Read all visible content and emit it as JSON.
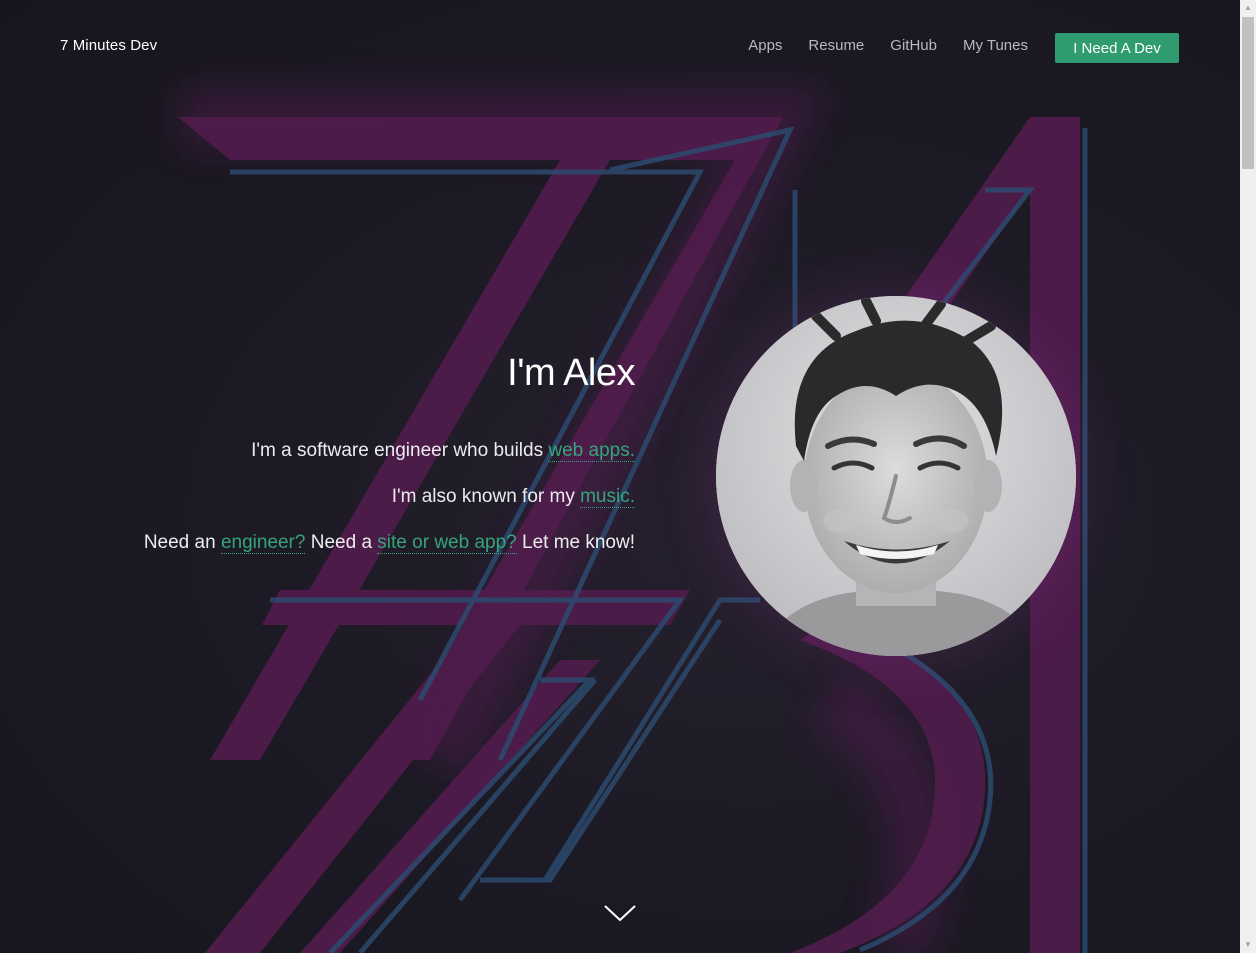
{
  "nav": {
    "brand": "7 Minutes Dev",
    "links": [
      "Apps",
      "Resume",
      "GitHub",
      "My Tunes"
    ],
    "cta": "I Need A Dev"
  },
  "intro": {
    "heading": "I'm Alex",
    "line1_text": "I'm a software engineer who builds ",
    "line1_link": "web apps.",
    "line2_text": "I'm also known for my ",
    "line2_link": "music.",
    "line3_text1": "Need an ",
    "line3_link1": "engineer?",
    "line3_text2": " Need a ",
    "line3_link2": "site or web app?",
    "line3_text3": " Let me know!"
  },
  "colors": {
    "accent": "#2e9c6e",
    "link": "#36a47a",
    "background": "#1c1a24",
    "art_magenta": "#5c1f55",
    "art_blue": "#2c4a6e"
  },
  "icons": {
    "scroll": "chevron-down-icon",
    "avatar": "profile-photo"
  }
}
